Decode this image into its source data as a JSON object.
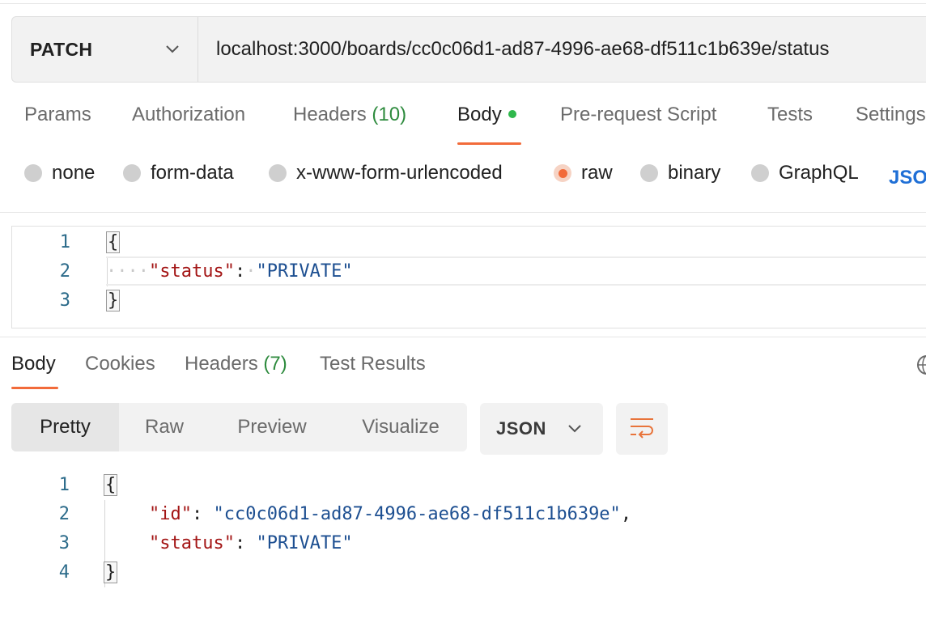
{
  "request": {
    "method": "PATCH",
    "url": "localhost:3000/boards/cc0c06d1-ad87-4996-ae68-df511c1b639e/status"
  },
  "request_tabs": {
    "params": "Params",
    "authorization": "Authorization",
    "headers": "Headers",
    "headers_count": "(10)",
    "body": "Body",
    "pre_request_script": "Pre-request Script",
    "tests": "Tests",
    "settings": "Settings"
  },
  "body_types": {
    "none": "none",
    "form_data": "form-data",
    "urlencoded": "x-www-form-urlencoded",
    "raw": "raw",
    "binary": "binary",
    "graphql": "GraphQL",
    "json": "JSON",
    "selected": "raw"
  },
  "request_body": {
    "lines": [
      {
        "num": "1",
        "open": "{"
      },
      {
        "num": "2",
        "indent": "····",
        "key": "\"status\"",
        "colon": ":",
        "space": "·",
        "value": "\"PRIVATE\""
      },
      {
        "num": "3",
        "close": "}"
      }
    ]
  },
  "response_tabs": {
    "body": "Body",
    "cookies": "Cookies",
    "headers": "Headers",
    "headers_count": "(7)",
    "test_results": "Test Results"
  },
  "response_view": {
    "pretty": "Pretty",
    "raw": "Raw",
    "preview": "Preview",
    "visualize": "Visualize",
    "format": "JSON"
  },
  "response_body": {
    "lines": [
      {
        "num": "1",
        "open": "{"
      },
      {
        "num": "2",
        "key": "\"id\"",
        "colon": ": ",
        "value": "\"cc0c06d1-ad87-4996-ae68-df511c1b639e\"",
        "comma": ","
      },
      {
        "num": "3",
        "key": "\"status\"",
        "colon": ": ",
        "value": "\"PRIVATE\""
      },
      {
        "num": "4",
        "close": "}"
      }
    ]
  },
  "colors": {
    "accent": "#f26b3a",
    "status_dot": "#2fb84c",
    "count_green": "#2e8b3e",
    "link_blue": "#1f6fd6",
    "json_key": "#a31515",
    "json_string": "#1d4f91"
  },
  "icons": {
    "method_dropdown": "chevron-down-icon",
    "format_dropdown": "chevron-down-icon",
    "wrap": "wrap-lines-icon",
    "globe": "globe-icon"
  }
}
